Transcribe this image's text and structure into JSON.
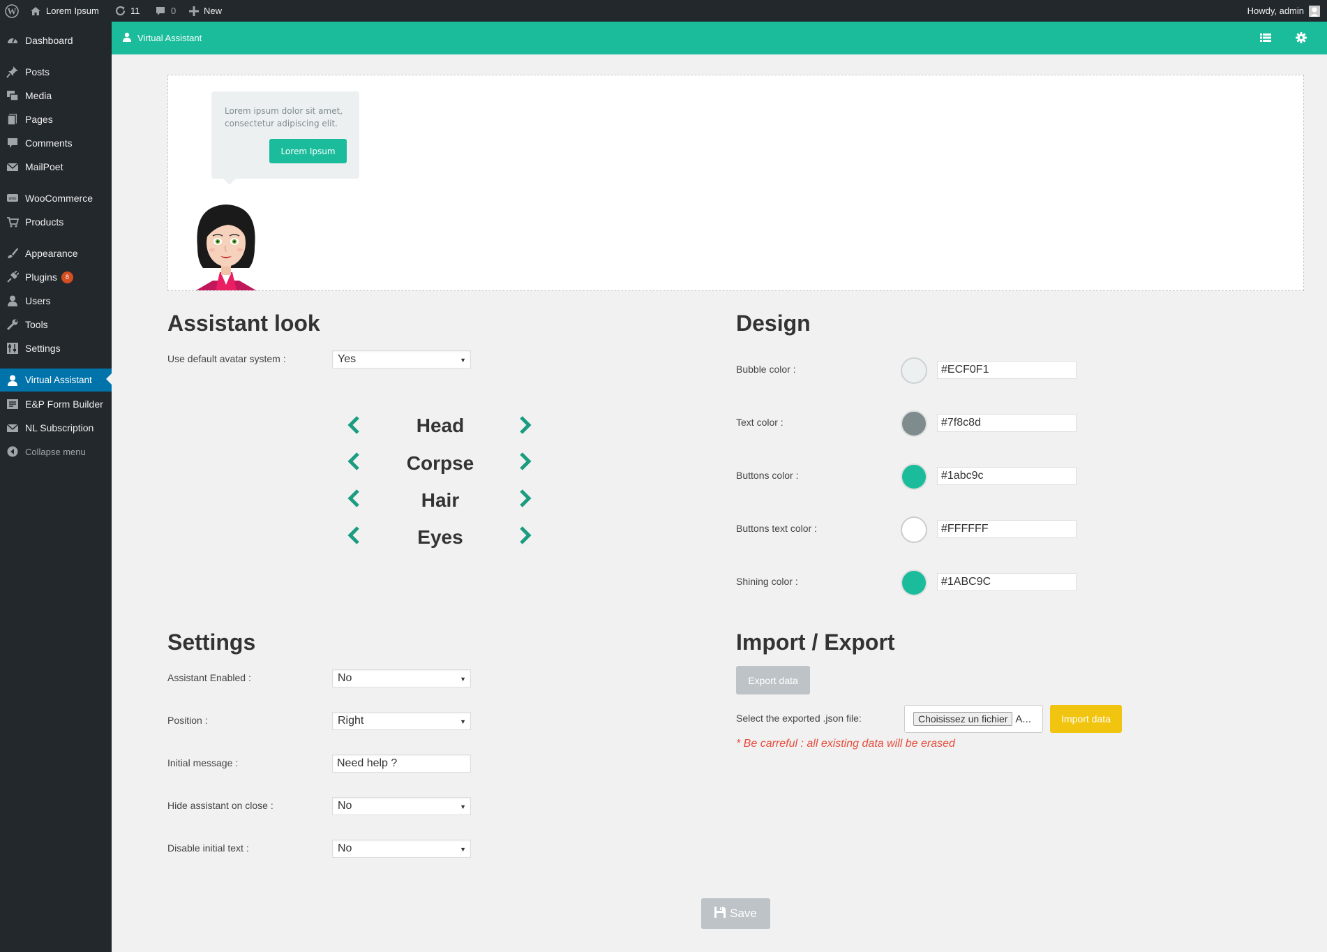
{
  "adminbar": {
    "site_name": "Lorem Ipsum",
    "updates_count": "11",
    "comments_count": "0",
    "new_label": "New",
    "howdy": "Howdy, admin"
  },
  "sidebar": {
    "items": [
      {
        "label": "Dashboard",
        "icon": "dashboard-icon"
      },
      {
        "label": "Posts",
        "icon": "pin-icon"
      },
      {
        "label": "Media",
        "icon": "media-icon"
      },
      {
        "label": "Pages",
        "icon": "pages-icon"
      },
      {
        "label": "Comments",
        "icon": "comment-icon"
      },
      {
        "label": "MailPoet",
        "icon": "mail-icon"
      },
      {
        "label": "WooCommerce",
        "icon": "woo-icon"
      },
      {
        "label": "Products",
        "icon": "cart-icon"
      },
      {
        "label": "Appearance",
        "icon": "brush-icon"
      },
      {
        "label": "Plugins",
        "icon": "plugin-icon",
        "badge": "8"
      },
      {
        "label": "Users",
        "icon": "user-icon"
      },
      {
        "label": "Tools",
        "icon": "wrench-icon"
      },
      {
        "label": "Settings",
        "icon": "settings-icon"
      },
      {
        "label": "Virtual Assistant",
        "icon": "user-icon",
        "current": true
      },
      {
        "label": "E&P Form Builder",
        "icon": "form-icon"
      },
      {
        "label": "NL Subscription",
        "icon": "mail-icon"
      }
    ],
    "collapse_label": "Collapse menu"
  },
  "header": {
    "title": "Virtual Assistant"
  },
  "preview": {
    "bubble_text": "Lorem ipsum dolor sit amet, consectetur adipiscing elit.",
    "bubble_button": "Lorem Ipsum"
  },
  "look": {
    "title": "Assistant look",
    "default_avatar_label": "Use default avatar system :",
    "default_avatar_value": "Yes",
    "parts": [
      "Head",
      "Corpse",
      "Hair",
      "Eyes"
    ]
  },
  "design": {
    "title": "Design",
    "colors": [
      {
        "label": "Bubble color :",
        "value": "#ECF0F1",
        "swatch": "#ECF0F1"
      },
      {
        "label": "Text color :",
        "value": "#7f8c8d",
        "swatch": "#7f8c8d"
      },
      {
        "label": "Buttons color :",
        "value": "#1abc9c",
        "swatch": "#1abc9c"
      },
      {
        "label": "Buttons text color :",
        "value": "#FFFFFF",
        "swatch": "#FFFFFF"
      },
      {
        "label": "Shining color :",
        "value": "#1ABC9C",
        "swatch": "#1ABC9C"
      }
    ]
  },
  "settings": {
    "title": "Settings",
    "rows": [
      {
        "label": "Assistant Enabled :",
        "value": "No",
        "type": "select"
      },
      {
        "label": "Position :",
        "value": "Right",
        "type": "select"
      },
      {
        "label": "Initial message :",
        "value": "Need help ?",
        "type": "text"
      },
      {
        "label": "Hide assistant on close :",
        "value": "No",
        "type": "select"
      },
      {
        "label": "Disable initial text :",
        "value": "No",
        "type": "select"
      }
    ]
  },
  "import_export": {
    "title": "Import / Export",
    "export_button": "Export data",
    "file_label": "Select the exported .json file:",
    "choose_button": "Choisissez un fichier",
    "file_status": "A...",
    "import_button": "Import data",
    "warning": "* Be carreful : all existing data will be erased"
  },
  "footer": {
    "save_button": "Save"
  },
  "colors": {
    "accent": "#1abc9c",
    "sidebar_bg": "#23282d",
    "current_menu": "#0073aa",
    "warning": "#e74c3c",
    "import_button": "#f1c40f"
  }
}
